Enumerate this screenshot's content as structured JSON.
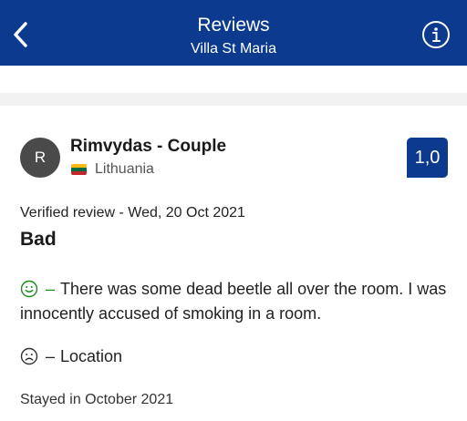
{
  "header": {
    "title": "Reviews",
    "subtitle": "Villa St Maria",
    "back_icon": "chevron-left-icon",
    "info_icon": "info-icon"
  },
  "review": {
    "avatar_initial": "R",
    "reviewer": "Rimvydas - Couple",
    "country": "Lithuania",
    "score": "1,0",
    "meta": "Verified review - Wed, 20 Oct 2021",
    "headline": "Bad",
    "positive_icon": "smile-icon",
    "positive_dash": "–",
    "positive_text": "There was some dead beetle all over the room. I was innocently accused of smoking in a room.",
    "negative_icon": "frown-icon",
    "negative_dash": "–",
    "negative_text": "Location",
    "stayed": "Stayed in October 2021"
  },
  "colors": {
    "brand": "#0b3a8e",
    "positive": "#1a8a1a",
    "flag": [
      "#fdb913",
      "#006a44",
      "#c1272d"
    ]
  }
}
